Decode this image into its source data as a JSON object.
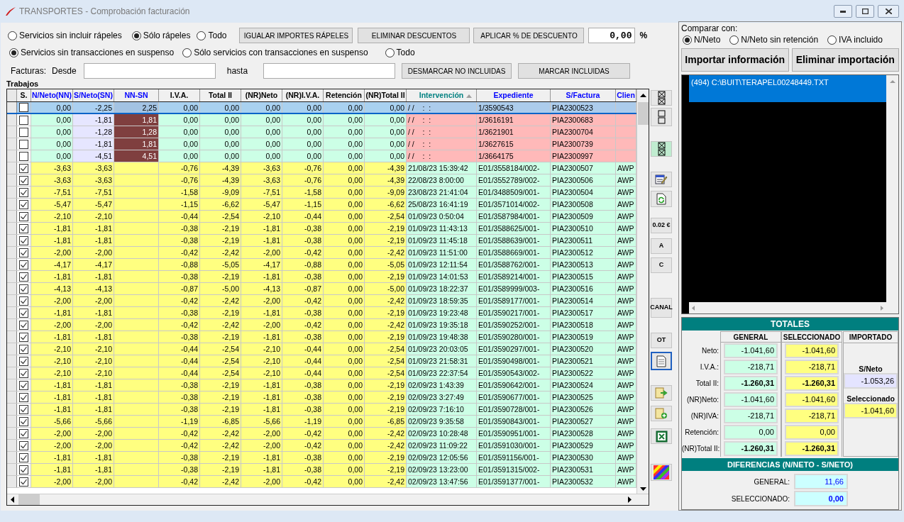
{
  "window": {
    "title": "TRANSPORTES - Comprobación facturación"
  },
  "filters": {
    "rapeles": [
      {
        "label": "Servicios sin incluir rápeles",
        "selected": false
      },
      {
        "label": "Sólo rápeles",
        "selected": true
      },
      {
        "label": "Todo",
        "selected": false
      }
    ],
    "suspense": [
      {
        "label": "Servicios sin transacciones en suspenso",
        "selected": true
      },
      {
        "label": "Sólo servicios con transacciones en suspenso",
        "selected": false
      },
      {
        "label": "Todo",
        "selected": false
      }
    ]
  },
  "actions": [
    "IGUALAR IMPORTES RÁPELES",
    "ELIMINAR DESCUENTOS",
    "APLICAR % DE DESCUENTO"
  ],
  "discount": {
    "value": "0,00",
    "unit": "%"
  },
  "invoices": {
    "label": "Facturas:",
    "from_label": "Desde",
    "to_label": "hasta",
    "buttons": [
      "DESMARCAR NO INCLUIDAS",
      "MARCAR INCLUIDAS"
    ]
  },
  "table": {
    "title": "Trabajos",
    "check_column": {
      "label": "S."
    },
    "columns": [
      {
        "label": "N/Neto(NN)",
        "color": "#0000ff",
        "sorted": false
      },
      {
        "label": "S/Neto(SN)",
        "color": "#0000ff",
        "sorted": false
      },
      {
        "label": "NN-SN",
        "color": "#0000ff",
        "sorted": false
      },
      {
        "label": "I.V.A.",
        "color": "#000000",
        "sorted": false
      },
      {
        "label": "Total II",
        "color": "#000000",
        "sorted": false
      },
      {
        "label": "(NR)Neto",
        "color": "#000000",
        "sorted": false
      },
      {
        "label": "(NR)I.V.A.",
        "color": "#000000",
        "sorted": false
      },
      {
        "label": "Retención",
        "color": "#000000",
        "sorted": false
      },
      {
        "label": "(NR)Total II",
        "color": "#000000",
        "sorted": false
      },
      {
        "label": "Intervención",
        "color": "#008080",
        "sorted": true
      },
      {
        "label": "Expediente",
        "color": "#0000ff",
        "sorted": false
      },
      {
        "label": "S/Factura",
        "color": "#0000ff",
        "sorted": false
      },
      {
        "label": "Clien",
        "color": "#0000ff",
        "sorted": false
      }
    ],
    "rows": [
      {
        "checked": false,
        "selected": true,
        "kind": "unmatched",
        "cells": [
          "0,00",
          "-2,25",
          "2,25",
          "0,00",
          "0,00",
          "0,00",
          "0,00",
          "0,00",
          "0,00",
          "/ /    :  :",
          "1/3590543",
          "PIA2300523",
          null
        ]
      },
      {
        "checked": false,
        "selected": false,
        "kind": "unmatched",
        "cells": [
          "0,00",
          "-1,81",
          "1,81",
          "0,00",
          "0,00",
          "0,00",
          "0,00",
          "0,00",
          "0,00",
          "/ /    :  :",
          "1/3616191",
          "PIA2300683",
          null
        ]
      },
      {
        "checked": false,
        "selected": false,
        "kind": "unmatched",
        "cells": [
          "0,00",
          "-1,28",
          "1,28",
          "0,00",
          "0,00",
          "0,00",
          "0,00",
          "0,00",
          "0,00",
          "/ /    :  :",
          "1/3621901",
          "PIA2300704",
          null
        ]
      },
      {
        "checked": false,
        "selected": false,
        "kind": "unmatched",
        "cells": [
          "0,00",
          "-1,81",
          "1,81",
          "0,00",
          "0,00",
          "0,00",
          "0,00",
          "0,00",
          "0,00",
          "/ /    :  :",
          "1/3627615",
          "PIA2300739",
          null
        ]
      },
      {
        "checked": false,
        "selected": false,
        "kind": "unmatched",
        "cells": [
          "0,00",
          "-4,51",
          "4,51",
          "0,00",
          "0,00",
          "0,00",
          "0,00",
          "0,00",
          "0,00",
          "/ /    :  :",
          "1/3664175",
          "PIA2300997",
          null
        ]
      },
      {
        "checked": true,
        "selected": false,
        "kind": "matched",
        "cells": [
          "-3,63",
          "-3,63",
          null,
          "-0,76",
          "-4,39",
          "-3,63",
          "-0,76",
          "0,00",
          "-4,39",
          "21/08/23 15:39:42",
          "E01/3558184/002-",
          "PIA2300507",
          "AWP"
        ]
      },
      {
        "checked": true,
        "selected": false,
        "kind": "matched",
        "cells": [
          "-3,63",
          "-3,63",
          null,
          "-0,76",
          "-4,39",
          "-3,63",
          "-0,76",
          "0,00",
          "-4,39",
          "22/08/23 8:00:00",
          "E01/3552789/002-",
          "PIA2300506",
          "AWP"
        ]
      },
      {
        "checked": true,
        "selected": false,
        "kind": "matched",
        "cells": [
          "-7,51",
          "-7,51",
          null,
          "-1,58",
          "-9,09",
          "-7,51",
          "-1,58",
          "0,00",
          "-9,09",
          "23/08/23 21:41:04",
          "E01/3488509/001-",
          "PIA2300504",
          "AWP"
        ]
      },
      {
        "checked": true,
        "selected": false,
        "kind": "matched",
        "cells": [
          "-5,47",
          "-5,47",
          null,
          "-1,15",
          "-6,62",
          "-5,47",
          "-1,15",
          "0,00",
          "-6,62",
          "25/08/23 16:41:19",
          "E01/3571014/002-",
          "PIA2300508",
          "AWP"
        ]
      },
      {
        "checked": true,
        "selected": false,
        "kind": "matched",
        "cells": [
          "-2,10",
          "-2,10",
          null,
          "-0,44",
          "-2,54",
          "-2,10",
          "-0,44",
          "0,00",
          "-2,54",
          "01/09/23 0:50:04",
          "E01/3587984/001-",
          "PIA2300509",
          "AWP"
        ]
      },
      {
        "checked": true,
        "selected": false,
        "kind": "matched",
        "cells": [
          "-1,81",
          "-1,81",
          null,
          "-0,38",
          "-2,19",
          "-1,81",
          "-0,38",
          "0,00",
          "-2,19",
          "01/09/23 11:43:13",
          "E01/3588625/001-",
          "PIA2300510",
          "AWP"
        ]
      },
      {
        "checked": true,
        "selected": false,
        "kind": "matched",
        "cells": [
          "-1,81",
          "-1,81",
          null,
          "-0,38",
          "-2,19",
          "-1,81",
          "-0,38",
          "0,00",
          "-2,19",
          "01/09/23 11:45:18",
          "E01/3588639/001-",
          "PIA2300511",
          "AWP"
        ]
      },
      {
        "checked": true,
        "selected": false,
        "kind": "matched",
        "cells": [
          "-2,00",
          "-2,00",
          null,
          "-0,42",
          "-2,42",
          "-2,00",
          "-0,42",
          "0,00",
          "-2,42",
          "01/09/23 11:51:00",
          "E01/3588669/001-",
          "PIA2300512",
          "AWP"
        ]
      },
      {
        "checked": true,
        "selected": false,
        "kind": "matched",
        "cells": [
          "-4,17",
          "-4,17",
          null,
          "-0,88",
          "-5,05",
          "-4,17",
          "-0,88",
          "0,00",
          "-5,05",
          "01/09/23 12:11:54",
          "E01/3588762/001-",
          "PIA2300513",
          "AWP"
        ]
      },
      {
        "checked": true,
        "selected": false,
        "kind": "matched",
        "cells": [
          "-1,81",
          "-1,81",
          null,
          "-0,38",
          "-2,19",
          "-1,81",
          "-0,38",
          "0,00",
          "-2,19",
          "01/09/23 14:01:53",
          "E01/3589214/001-",
          "PIA2300515",
          "AWP"
        ]
      },
      {
        "checked": true,
        "selected": false,
        "kind": "matched",
        "cells": [
          "-4,13",
          "-4,13",
          null,
          "-0,87",
          "-5,00",
          "-4,13",
          "-0,87",
          "0,00",
          "-5,00",
          "01/09/23 18:22:37",
          "E01/3589999/003-",
          "PIA2300516",
          "AWP"
        ]
      },
      {
        "checked": true,
        "selected": false,
        "kind": "matched",
        "cells": [
          "-2,00",
          "-2,00",
          null,
          "-0,42",
          "-2,42",
          "-2,00",
          "-0,42",
          "0,00",
          "-2,42",
          "01/09/23 18:59:35",
          "E01/3589177/001-",
          "PIA2300514",
          "AWP"
        ]
      },
      {
        "checked": true,
        "selected": false,
        "kind": "matched",
        "cells": [
          "-1,81",
          "-1,81",
          null,
          "-0,38",
          "-2,19",
          "-1,81",
          "-0,38",
          "0,00",
          "-2,19",
          "01/09/23 19:23:48",
          "E01/3590217/001-",
          "PIA2300517",
          "AWP"
        ]
      },
      {
        "checked": true,
        "selected": false,
        "kind": "matched",
        "cells": [
          "-2,00",
          "-2,00",
          null,
          "-0,42",
          "-2,42",
          "-2,00",
          "-0,42",
          "0,00",
          "-2,42",
          "01/09/23 19:35:18",
          "E01/3590252/001-",
          "PIA2300518",
          "AWP"
        ]
      },
      {
        "checked": true,
        "selected": false,
        "kind": "matched",
        "cells": [
          "-1,81",
          "-1,81",
          null,
          "-0,38",
          "-2,19",
          "-1,81",
          "-0,38",
          "0,00",
          "-2,19",
          "01/09/23 19:48:38",
          "E01/3590280/001-",
          "PIA2300519",
          "AWP"
        ]
      },
      {
        "checked": true,
        "selected": false,
        "kind": "matched",
        "cells": [
          "-2,10",
          "-2,10",
          null,
          "-0,44",
          "-2,54",
          "-2,10",
          "-0,44",
          "0,00",
          "-2,54",
          "01/09/23 20:03:05",
          "E01/3590297/001-",
          "PIA2300520",
          "AWP"
        ]
      },
      {
        "checked": true,
        "selected": false,
        "kind": "matched",
        "cells": [
          "-2,10",
          "-2,10",
          null,
          "-0,44",
          "-2,54",
          "-2,10",
          "-0,44",
          "0,00",
          "-2,54",
          "01/09/23 21:58:31",
          "E01/3590498/001-",
          "PIA2300521",
          "AWP"
        ]
      },
      {
        "checked": true,
        "selected": false,
        "kind": "matched",
        "cells": [
          "-2,10",
          "-2,10",
          null,
          "-0,44",
          "-2,54",
          "-2,10",
          "-0,44",
          "0,00",
          "-2,54",
          "01/09/23 22:37:54",
          "E01/3590543/002-",
          "PIA2300522",
          "AWP"
        ]
      },
      {
        "checked": true,
        "selected": false,
        "kind": "matched",
        "cells": [
          "-1,81",
          "-1,81",
          null,
          "-0,38",
          "-2,19",
          "-1,81",
          "-0,38",
          "0,00",
          "-2,19",
          "02/09/23 1:43:39",
          "E01/3590642/001-",
          "PIA2300524",
          "AWP"
        ]
      },
      {
        "checked": true,
        "selected": false,
        "kind": "matched",
        "cells": [
          "-1,81",
          "-1,81",
          null,
          "-0,38",
          "-2,19",
          "-1,81",
          "-0,38",
          "0,00",
          "-2,19",
          "02/09/23 3:27:49",
          "E01/3590677/001-",
          "PIA2300525",
          "AWP"
        ]
      },
      {
        "checked": true,
        "selected": false,
        "kind": "matched",
        "cells": [
          "-1,81",
          "-1,81",
          null,
          "-0,38",
          "-2,19",
          "-1,81",
          "-0,38",
          "0,00",
          "-2,19",
          "02/09/23 7:16:10",
          "E01/3590728/001-",
          "PIA2300526",
          "AWP"
        ]
      },
      {
        "checked": true,
        "selected": false,
        "kind": "matched",
        "cells": [
          "-5,66",
          "-5,66",
          null,
          "-1,19",
          "-6,85",
          "-5,66",
          "-1,19",
          "0,00",
          "-6,85",
          "02/09/23 9:35:58",
          "E01/3590843/001-",
          "PIA2300527",
          "AWP"
        ]
      },
      {
        "checked": true,
        "selected": false,
        "kind": "matched",
        "cells": [
          "-2,00",
          "-2,00",
          null,
          "-0,42",
          "-2,42",
          "-2,00",
          "-0,42",
          "0,00",
          "-2,42",
          "02/09/23 10:28:48",
          "E01/3590951/001-",
          "PIA2300528",
          "AWP"
        ]
      },
      {
        "checked": true,
        "selected": false,
        "kind": "matched",
        "cells": [
          "-2,00",
          "-2,00",
          null,
          "-0,42",
          "-2,42",
          "-2,00",
          "-0,42",
          "0,00",
          "-2,42",
          "02/09/23 11:09:22",
          "E01/3591030/001-",
          "PIA2300529",
          "AWP"
        ]
      },
      {
        "checked": true,
        "selected": false,
        "kind": "matched",
        "cells": [
          "-1,81",
          "-1,81",
          null,
          "-0,38",
          "-2,19",
          "-1,81",
          "-0,38",
          "0,00",
          "-2,19",
          "02/09/23 12:05:56",
          "E01/3591156/001-",
          "PIA2300530",
          "AWP"
        ]
      },
      {
        "checked": true,
        "selected": false,
        "kind": "matched",
        "cells": [
          "-1,81",
          "-1,81",
          null,
          "-0,38",
          "-2,19",
          "-1,81",
          "-0,38",
          "0,00",
          "-2,19",
          "02/09/23 13:23:00",
          "E01/3591315/002-",
          "PIA2300531",
          "AWP"
        ]
      },
      {
        "checked": true,
        "selected": false,
        "kind": "matched",
        "cells": [
          "-2,00",
          "-2,00",
          null,
          "-0,42",
          "-2,42",
          "-2,00",
          "-0,42",
          "0,00",
          "-2,42",
          "02/09/23 13:47:56",
          "E01/3591377/001-",
          "PIA2300532",
          "AWP"
        ]
      }
    ]
  },
  "toolbar": [
    {
      "kind": "icon",
      "highlighted": false,
      "focused": false
    },
    {
      "kind": "icon",
      "highlighted": false,
      "focused": false
    },
    {
      "kind": "icon",
      "highlighted": true,
      "focused": false
    },
    {
      "kind": "icon",
      "highlighted": false,
      "focused": false
    },
    {
      "kind": "icon",
      "highlighted": false,
      "focused": false
    },
    {
      "kind": "text",
      "label": "0.02 €",
      "highlighted": false,
      "focused": false
    },
    {
      "kind": "text",
      "label": "A",
      "highlighted": false,
      "focused": false
    },
    {
      "kind": "text",
      "label": "C",
      "highlighted": false,
      "focused": false
    },
    {
      "kind": "text",
      "label": "CANAL",
      "highlighted": false,
      "focused": false
    },
    {
      "kind": "text",
      "label": "OT",
      "highlighted": false,
      "focused": false
    },
    {
      "kind": "icon",
      "highlighted": false,
      "focused": true
    },
    {
      "kind": "icon",
      "highlighted": false,
      "focused": false
    },
    {
      "kind": "icon",
      "highlighted": false,
      "focused": false
    },
    {
      "kind": "icon",
      "highlighted": false,
      "focused": false
    },
    {
      "kind": "icon",
      "highlighted": false,
      "focused": false
    }
  ],
  "compare": {
    "label": "Comparar con:",
    "options": [
      {
        "label": "N/Neto",
        "selected": true
      },
      {
        "label": "N/Neto sin retención",
        "selected": false
      },
      {
        "label": "IVA incluido",
        "selected": false
      }
    ],
    "buttons": [
      "Importar información",
      "Eliminar importación"
    ],
    "files": [
      {
        "label": "(494) C:\\BUIT\\TERAPEL00248449.TXT",
        "selected": true
      }
    ]
  },
  "totals": {
    "title": "TOTALES",
    "columns": [
      "GENERAL",
      "SELECCIONADO",
      "IMPORTADO"
    ],
    "rows": [
      {
        "label": "Neto:",
        "values": [
          "-1.041,60",
          "-1.041,60"
        ],
        "bold": false
      },
      {
        "label": "I.V.A.:",
        "values": [
          "-218,71",
          "-218,71"
        ],
        "bold": false
      },
      {
        "label": "Total II:",
        "values": [
          "-1.260,31",
          "-1.260,31"
        ],
        "bold": true
      },
      {
        "label": "(NR)Neto:",
        "values": [
          "-1.041,60",
          "-1.041,60"
        ],
        "bold": false
      },
      {
        "label": "(NR)IVA:",
        "values": [
          "-218,71",
          "-218,71"
        ],
        "bold": false
      },
      {
        "label": "Retención:",
        "values": [
          "0,00",
          "0,00"
        ],
        "bold": false
      },
      {
        "label": "(NR)Total II:",
        "values": [
          "-1.260,31",
          "-1.260,31"
        ],
        "bold": true
      }
    ],
    "imported": [
      {
        "label": "S/Neto",
        "value": "-1.053,26",
        "kind": "total"
      },
      {
        "label": "Seleccionado",
        "value": "-1.041,60",
        "kind": "selection"
      }
    ]
  },
  "differences": {
    "title": "DIFERENCIAS (N/NETO - S/NETO)",
    "rows": [
      {
        "label": "GENERAL:",
        "value": "11,66",
        "bold": false
      },
      {
        "label": "SELECCIONADO:",
        "value": "0,00",
        "bold": true
      }
    ]
  }
}
